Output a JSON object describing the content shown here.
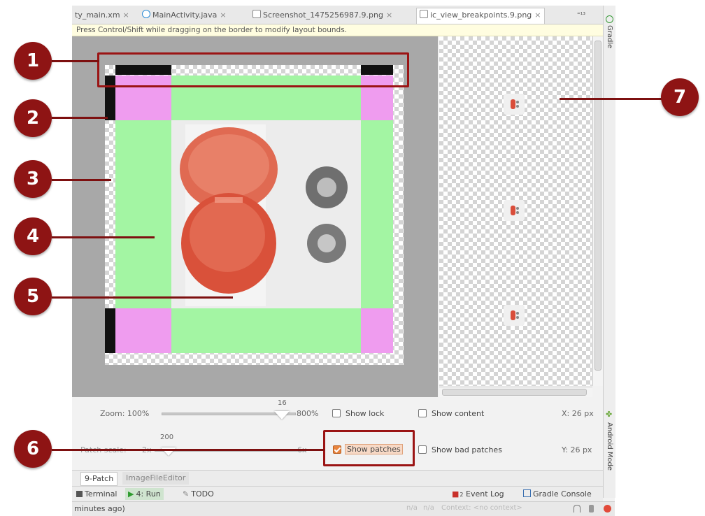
{
  "tabs": [
    {
      "label": "ty_main.xm",
      "icon": "xml-file-icon"
    },
    {
      "label": "MainActivity.java",
      "icon": "java-class-icon"
    },
    {
      "label": "Screenshot_1475256987.9.png",
      "icon": "image-file-icon"
    },
    {
      "label": "ic_view_breakpoints.9.png",
      "icon": "image-file-icon",
      "active": true
    }
  ],
  "tab_close": "×",
  "tab_overflow": "⁼¹³",
  "hint": "Press Control/Shift while dragging on the border to modify layout bounds.",
  "side_tool_windows": {
    "gradle": "Gradle",
    "android_model": "Android Mode"
  },
  "controls": {
    "zoom_label": "Zoom: 100%",
    "zoom_value": "16",
    "zoom_max": "800%",
    "patch_label": "Patch scale:",
    "patch_min": "2x",
    "patch_value": "200",
    "patch_max": "6x",
    "show_lock": "Show lock",
    "show_content": "Show content",
    "show_patches": "Show patches",
    "show_bad_patches": "Show bad patches",
    "x_readout": "X: 26 px",
    "y_readout": "Y: 26 px",
    "show_lock_checked": false,
    "show_content_checked": false,
    "show_patches_checked": true,
    "show_bad_patches_checked": false
  },
  "bottom_tabs": [
    "9-Patch",
    "ImageFileEditor"
  ],
  "toolwindows": {
    "terminal": "Terminal",
    "run": "4: Run",
    "todo": "TODO",
    "event_log": "Event Log",
    "event_log_count": "2",
    "gradle_console": "Gradle Console"
  },
  "status": {
    "left": "minutes ago)",
    "na1": "n/a",
    "na2": "n/a",
    "context": "Context: <no context>"
  },
  "callouts": [
    "1",
    "2",
    "3",
    "4",
    "5",
    "6",
    "7"
  ],
  "colors": {
    "callout": "#8e1414",
    "stretch_region": "#a3f5a3",
    "corner_region": "#ef9cef",
    "checked_box": "#e8843e"
  }
}
